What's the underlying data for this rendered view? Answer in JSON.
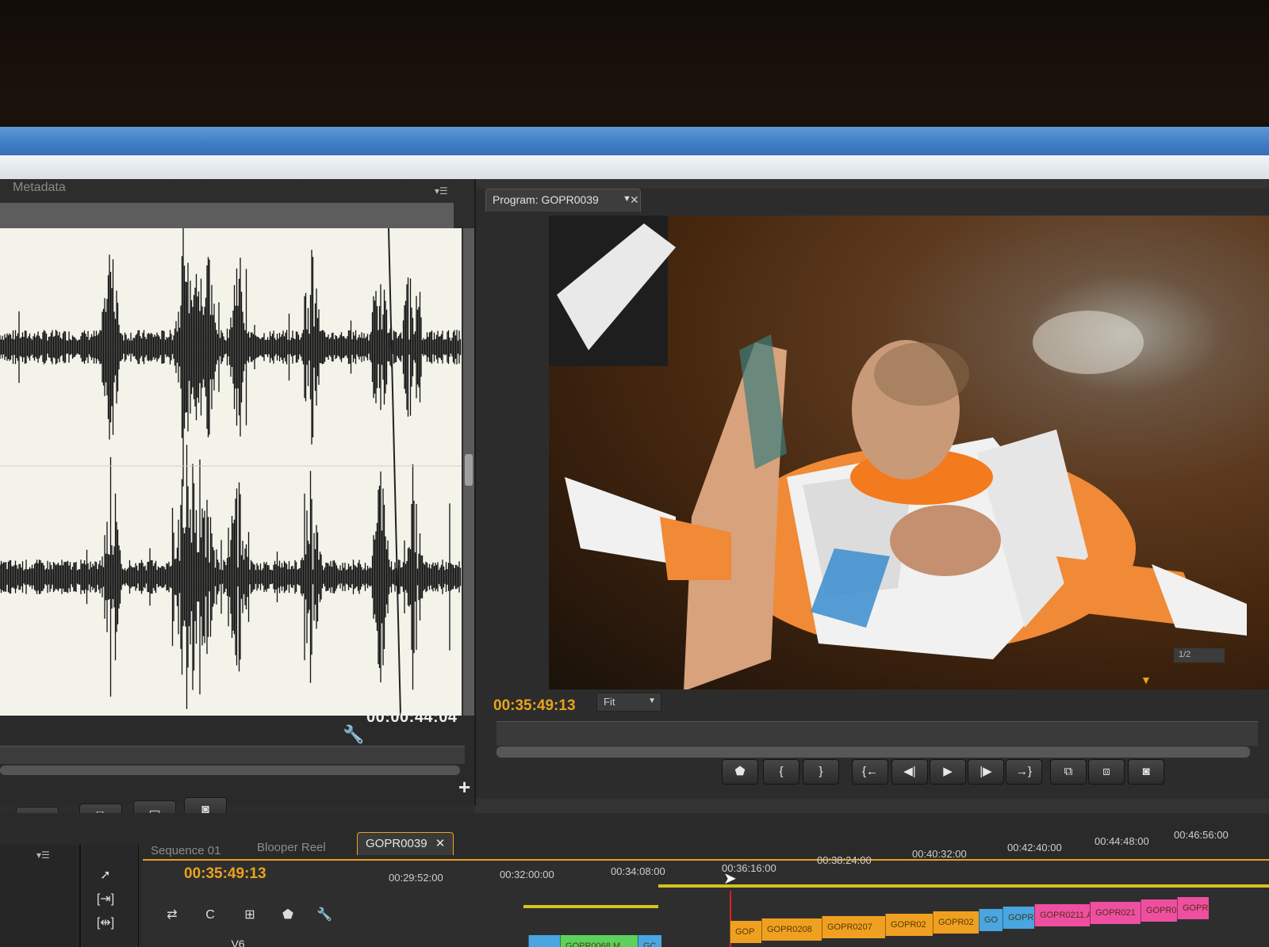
{
  "source_panel": {
    "tab": "Metadata",
    "timecode": "00:00:44:04"
  },
  "program_monitor": {
    "tab_title": "Program: GOPR0039",
    "timecode": "00:35:49:13",
    "zoom": "Fit",
    "resolution": "1/2"
  },
  "timeline": {
    "tabs": [
      "Sequence 01",
      "Blooper Reel",
      "GOPR0039"
    ],
    "active_tab": "GOPR0039",
    "timecode": "00:35:49:13",
    "ruler_labels": [
      "00:29:52:00",
      "00:32:00:00",
      "00:34:08:00",
      "00:36:16:00",
      "00:38:24:00",
      "00:40:32:00",
      "00:42:40:00",
      "00:44:48:00",
      "00:46:56:00"
    ],
    "track_label": "V6",
    "clips_upper": [
      "GOP",
      "GOPR0208",
      "GOPR0207",
      "GOPR02",
      "GOPR02",
      "GO",
      "GOPR",
      "GOPR0211.A",
      "GOPR021",
      "GOPR0",
      "GOPR"
    ],
    "clips_lower": [
      "",
      "GOPR0068.M",
      "GC"
    ]
  },
  "colors": {
    "accent_orange": "#e8a31d",
    "playhead_red": "#dd2222",
    "clip_orange": "#f0a020",
    "clip_blue": "#4aa6e0",
    "clip_pink": "#ee4fa0",
    "clip_green": "#5dd05d",
    "waveform_bg": "#f3f3ea"
  },
  "icons": {
    "wrench": "wrench-icon",
    "plus": "plus-icon",
    "camera": "camera-icon",
    "play": "play-icon",
    "step_back": "step-back-icon",
    "step_forward": "step-forward-icon",
    "marker": "marker-icon",
    "selection_tool": "arrow-cursor-icon"
  }
}
